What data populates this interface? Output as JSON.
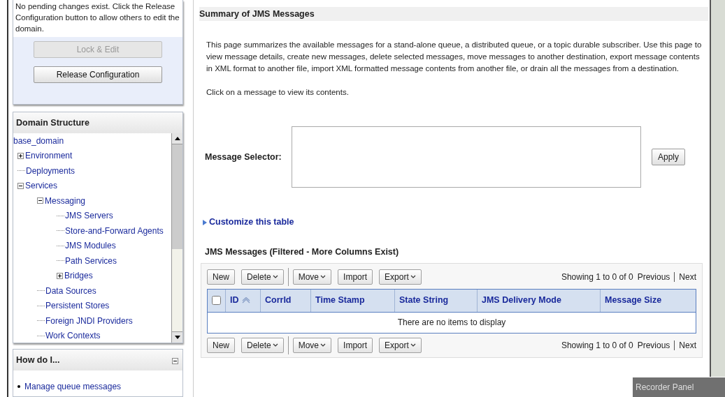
{
  "change_center": {
    "message": "No pending changes exist. Click the Release Configuration button to allow others to edit the domain.",
    "buttons": [
      {
        "label": "Lock & Edit",
        "disabled": true
      },
      {
        "label": "Release Configuration",
        "disabled": false
      }
    ]
  },
  "domain_structure": {
    "title": "Domain Structure",
    "tree": [
      {
        "label": "base_domain",
        "children": [
          {
            "label": "Environment",
            "expanded": false
          },
          {
            "label": "Deployments"
          },
          {
            "label": "Services",
            "expanded": true,
            "children": [
              {
                "label": "Messaging",
                "expanded": true,
                "children": [
                  {
                    "label": "JMS Servers"
                  },
                  {
                    "label": "Store-and-Forward Agents"
                  },
                  {
                    "label": "JMS Modules"
                  },
                  {
                    "label": "Path Services"
                  },
                  {
                    "label": "Bridges",
                    "expanded": false
                  }
                ]
              },
              {
                "label": "Data Sources"
              },
              {
                "label": "Persistent Stores"
              },
              {
                "label": "Foreign JNDI Providers"
              },
              {
                "label": "Work Contexts"
              }
            ]
          }
        ]
      }
    ]
  },
  "how_do_i": {
    "title": "How do I...",
    "expanded": true,
    "items": [
      "Manage queue messages"
    ]
  },
  "main": {
    "title": "Summary of JMS Messages",
    "description": "This page summarizes the available messages for a stand-alone queue, a distributed queue, or a topic durable subscriber. Use this page to view message details, create new messages, delete selected messages, move messages to another destination, export message contents in XML format to another file, import XML formatted message contents from another file, or drain all the messages from a destination.",
    "hint": "Click on a message to view its contents.",
    "selector": {
      "label": "Message Selector:",
      "button": "Apply"
    },
    "customize_link": "Customize this table",
    "table": {
      "title": "JMS Messages (Filtered - More Columns Exist)",
      "toolbars": [
        {
          "buttons": [
            {
              "label": "New",
              "kind": "button"
            },
            {
              "label": "Delete",
              "kind": "menu"
            },
            {
              "label": "Move",
              "kind": "menu"
            },
            {
              "label": "Import",
              "kind": "button"
            },
            {
              "label": "Export",
              "kind": "menu"
            }
          ],
          "paging": {
            "showing": "Showing 1 to 0 of 0",
            "previous": "Previous",
            "next": "Next"
          }
        },
        {
          "buttons": [
            {
              "label": "New",
              "kind": "button"
            },
            {
              "label": "Delete",
              "kind": "menu"
            },
            {
              "label": "Move",
              "kind": "menu"
            },
            {
              "label": "Import",
              "kind": "button"
            },
            {
              "label": "Export",
              "kind": "menu"
            }
          ],
          "paging": {
            "showing": "Showing 1 to 0 of 0",
            "previous": "Previous",
            "next": "Next"
          }
        }
      ],
      "select_all": {
        "checked": false
      },
      "columns": [
        {
          "label": "ID",
          "sorted": true
        },
        {
          "label": "CorrId",
          "sorted": false
        },
        {
          "label": "Time Stamp",
          "sorted": false
        },
        {
          "label": "State String",
          "sorted": false
        },
        {
          "label": "JMS Delivery Mode",
          "sorted": false
        },
        {
          "label": "Message Size",
          "sorted": false
        }
      ],
      "empty_message": "There are no items to display"
    }
  },
  "recorder_panel": {
    "title": "Recorder Panel"
  }
}
